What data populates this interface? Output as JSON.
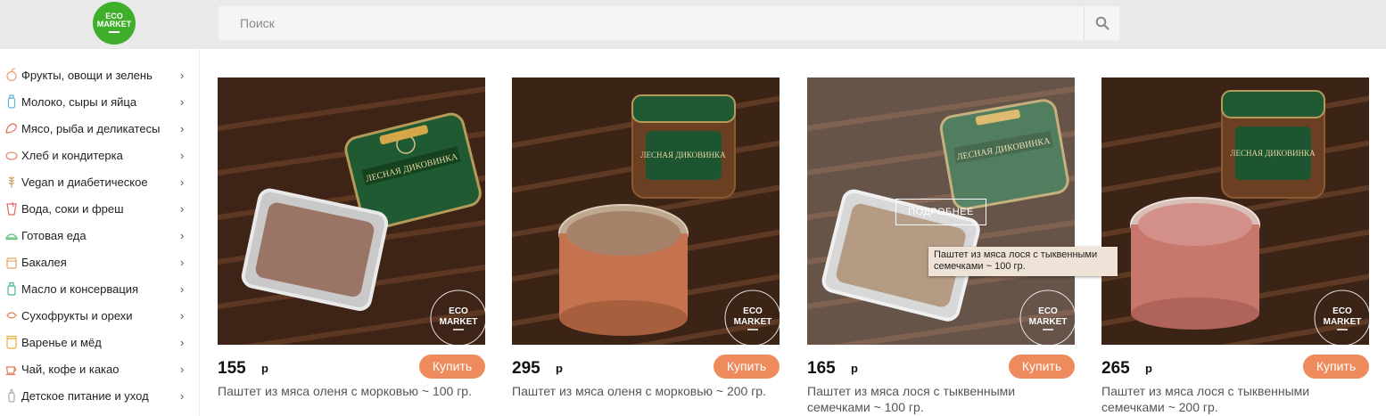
{
  "brand": {
    "logo_line1": "ECO",
    "logo_line2": "MARKET"
  },
  "search": {
    "placeholder": "Поиск"
  },
  "categories": [
    {
      "label": "Фрукты, овощи и зелень",
      "icon": "fruit-icon"
    },
    {
      "label": "Молоко, сыры и яйца",
      "icon": "milk-icon"
    },
    {
      "label": "Мясо, рыба и деликатесы",
      "icon": "meat-icon"
    },
    {
      "label": "Хлеб и кондитерка",
      "icon": "bread-icon"
    },
    {
      "label": "Vegan и диабетическое",
      "icon": "wheat-icon"
    },
    {
      "label": "Вода, соки и фреш",
      "icon": "drink-icon"
    },
    {
      "label": "Готовая еда",
      "icon": "dish-icon"
    },
    {
      "label": "Бакалея",
      "icon": "grocery-icon"
    },
    {
      "label": "Масло и консервация",
      "icon": "oil-icon"
    },
    {
      "label": "Сухофрукты и орехи",
      "icon": "nuts-icon"
    },
    {
      "label": "Варенье и мёд",
      "icon": "jam-icon"
    },
    {
      "label": "Чай, кофе и какао",
      "icon": "tea-icon"
    },
    {
      "label": "Детское питание и уход",
      "icon": "baby-bottle-icon"
    }
  ],
  "buy_label": "Купить",
  "currency": "р",
  "products": [
    {
      "price": "155",
      "name": "Паштет из мяса оленя с морковью ~ 100 гр."
    },
    {
      "price": "295",
      "name": "Паштет из мяса оленя с морковью ~ 200 гр."
    },
    {
      "price": "165",
      "name": "Паштет из мяса лося с тыквенными семечками ~ 100 гр."
    },
    {
      "price": "265",
      "name": "Паштет из мяса лося с тыквенными семечками ~ 200 гр."
    }
  ],
  "product_image_text": {
    "brand_label": "ЛЕСНАЯ ДИКОВИНКА",
    "watermark_line1": "ECO",
    "watermark_line2": "MARKET"
  },
  "hover": {
    "more_label": "ПОДРОБНЕЕ",
    "tooltip": "Паштет из мяса лося с тыквенными семечками ~ 100 гр."
  },
  "colors": {
    "accent": "#ed8b5c",
    "logo_green": "#3fae2a",
    "header_bg": "#e9e9e9"
  }
}
